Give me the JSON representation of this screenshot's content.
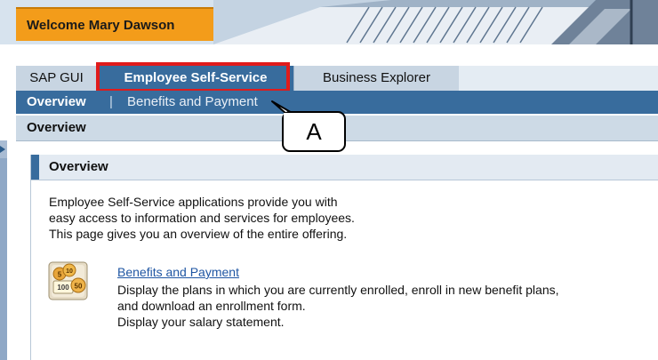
{
  "header": {
    "welcome_text": "Welcome Mary Dawson"
  },
  "tabs": [
    {
      "label": "SAP GUI",
      "selected": false
    },
    {
      "label": "Employee Self-Service",
      "selected": true
    },
    {
      "label": "Business Explorer",
      "selected": false
    }
  ],
  "subnav": {
    "items": [
      "Overview",
      "Benefits and Payment"
    ],
    "separator": "|"
  },
  "page": {
    "title": "Overview"
  },
  "panel": {
    "title": "Overview",
    "intro_lines": [
      "Employee Self-Service applications provide you with",
      "easy access to information and services for employees.",
      "This page gives you an overview of the entire offering."
    ]
  },
  "service": {
    "icon": "coins-icon",
    "link": "Benefits and Payment",
    "description_lines": [
      "Display the plans in which you are currently enrolled, enroll in new benefit plans,",
      "and download an enrollment form.",
      "Display your salary statement."
    ],
    "coin_labels": [
      "5",
      "10",
      "100",
      "50"
    ]
  },
  "annotation": {
    "label": "A"
  },
  "colors": {
    "accent": "#386c9d",
    "welcome": "#f39c1a",
    "highlight": "#e01b1b",
    "link": "#1f56a3"
  }
}
